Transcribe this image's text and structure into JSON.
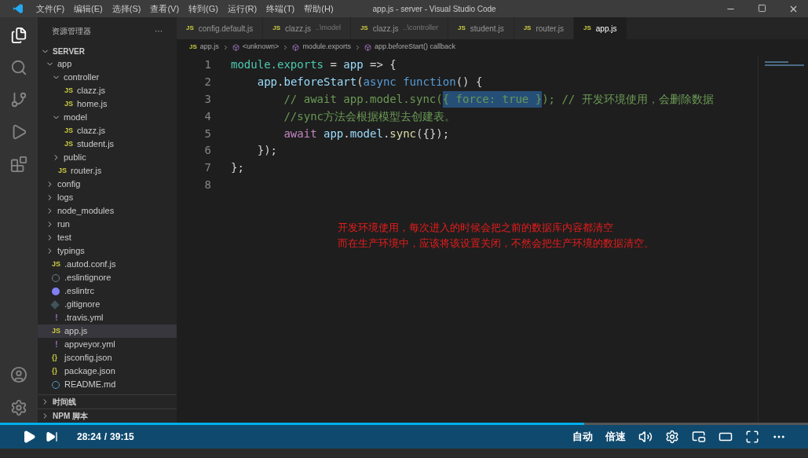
{
  "window": {
    "title": "app.js - server - Visual Studio Code",
    "menu": [
      "文件(F)",
      "编辑(E)",
      "选择(S)",
      "查看(V)",
      "转到(G)",
      "运行(R)",
      "终端(T)",
      "帮助(H)"
    ]
  },
  "sidebar": {
    "title": "资源管理器",
    "more": "···",
    "root": "SERVER",
    "tree": [
      {
        "label": "app",
        "kind": "folder",
        "expanded": true,
        "selected": false,
        "children": [
          {
            "label": "controller",
            "kind": "folder",
            "expanded": true,
            "selected": false,
            "children": [
              {
                "label": "clazz.js",
                "kind": "js",
                "icon": "JS",
                "selected": false
              },
              {
                "label": "home.js",
                "kind": "js",
                "icon": "JS",
                "selected": false
              }
            ]
          },
          {
            "label": "model",
            "kind": "folder",
            "expanded": true,
            "selected": false,
            "children": [
              {
                "label": "clazz.js",
                "kind": "js",
                "icon": "JS",
                "selected": false
              },
              {
                "label": "student.js",
                "kind": "js",
                "icon": "JS",
                "selected": false
              }
            ]
          },
          {
            "label": "public",
            "kind": "folder",
            "expanded": false,
            "selected": false
          },
          {
            "label": "router.js",
            "kind": "js",
            "icon": "JS",
            "selected": false
          }
        ]
      },
      {
        "label": "config",
        "kind": "folder",
        "expanded": false,
        "selected": false
      },
      {
        "label": "logs",
        "kind": "folder",
        "expanded": false,
        "selected": false
      },
      {
        "label": "node_modules",
        "kind": "folder",
        "expanded": false,
        "selected": false
      },
      {
        "label": "run",
        "kind": "folder",
        "expanded": false,
        "selected": false
      },
      {
        "label": "test",
        "kind": "folder",
        "expanded": false,
        "selected": false
      },
      {
        "label": "typings",
        "kind": "folder",
        "expanded": false,
        "selected": false
      },
      {
        "label": ".autod.conf.js",
        "kind": "js",
        "icon": "JS",
        "selected": false
      },
      {
        "label": ".eslintignore",
        "kind": "ignore",
        "selected": false
      },
      {
        "label": ".eslintrc",
        "kind": "eslint",
        "selected": false
      },
      {
        "label": ".gitignore",
        "kind": "git",
        "selected": false
      },
      {
        "label": ".travis.yml",
        "kind": "yaml",
        "icon": "!",
        "selected": false
      },
      {
        "label": "app.js",
        "kind": "js",
        "icon": "JS",
        "selected": true
      },
      {
        "label": "appveyor.yml",
        "kind": "yaml",
        "icon": "!",
        "selected": false
      },
      {
        "label": "jsconfig.json",
        "kind": "json",
        "icon": "{}",
        "selected": false
      },
      {
        "label": "package.json",
        "kind": "json",
        "icon": "{}",
        "selected": false
      },
      {
        "label": "README.md",
        "kind": "info",
        "selected": false
      }
    ],
    "sections": [
      {
        "label": "时间线",
        "expanded": false
      },
      {
        "label": "NPM 脚本",
        "expanded": false
      }
    ]
  },
  "tabs": [
    {
      "icon": "JS",
      "label": "config.default.js",
      "selected": false
    },
    {
      "icon": "JS",
      "label": "clazz.js",
      "description": "..\\model",
      "selected": false
    },
    {
      "icon": "JS",
      "label": "clazz.js",
      "description": "..\\controller",
      "selected": false
    },
    {
      "icon": "JS",
      "label": "student.js",
      "selected": false
    },
    {
      "icon": "JS",
      "label": "router.js",
      "selected": false
    },
    {
      "icon": "JS",
      "label": "app.js",
      "selected": true
    }
  ],
  "breadcrumb": [
    {
      "label": "app.js",
      "kind": "file",
      "icon": "JS"
    },
    {
      "label": "<unknown>",
      "kind": "symbol"
    },
    {
      "label": "module.exports",
      "kind": "symbol"
    },
    {
      "label": "app.beforeStart() callback",
      "kind": "symbol"
    }
  ],
  "code": [
    {
      "number": "1",
      "tokens": [
        {
          "text": "module.exports",
          "kind": "green"
        },
        {
          "text": " = ",
          "kind": "plain"
        },
        {
          "text": "app",
          "kind": "variable"
        },
        {
          "text": " => {",
          "kind": "plain"
        }
      ]
    },
    {
      "number": "2",
      "tokens": [
        {
          "text": "    app",
          "kind": "variable"
        },
        {
          "text": ".",
          "kind": "plain"
        },
        {
          "text": "beforeStart",
          "kind": "variable"
        },
        {
          "text": "(",
          "kind": "plain"
        },
        {
          "text": "async function",
          "kind": "keyword"
        },
        {
          "text": "() {",
          "kind": "plain"
        }
      ]
    },
    {
      "number": "3",
      "tokens": [
        {
          "text": "        // await app.model.sync(",
          "kind": "comment"
        },
        {
          "text": "{ force: true }",
          "kind": "selected"
        },
        {
          "text": "); // 开发环境使用，会删除数据",
          "kind": "comment"
        }
      ]
    },
    {
      "number": "4",
      "tokens": [
        {
          "text": "        //sync方法会根据模型去创建表。",
          "kind": "comment"
        }
      ]
    },
    {
      "number": "5",
      "tokens": [
        {
          "text": "        await",
          "kind": "control"
        },
        {
          "text": " app",
          "kind": "variable"
        },
        {
          "text": ".",
          "kind": "plain"
        },
        {
          "text": "model",
          "kind": "variable"
        },
        {
          "text": ".",
          "kind": "plain"
        },
        {
          "text": "sync",
          "kind": "function"
        },
        {
          "text": "({});",
          "kind": "plain"
        }
      ]
    },
    {
      "number": "6",
      "tokens": [
        {
          "text": "    });",
          "kind": "plain"
        }
      ]
    },
    {
      "number": "7",
      "tokens": [
        {
          "text": "};",
          "kind": "plain"
        }
      ]
    },
    {
      "number": "8"
    }
  ],
  "annotation": [
    "开发环境使用，每次进入的时候会把之前的数据库内容都清空",
    "而在生产环境中，应该将该设置关闭，不然会把生产环境的数据清空。"
  ],
  "player": {
    "level": 0.7235,
    "current": "28:24",
    "separator": "/",
    "total": "39:15",
    "quality": "自动",
    "speed": "倍速"
  }
}
